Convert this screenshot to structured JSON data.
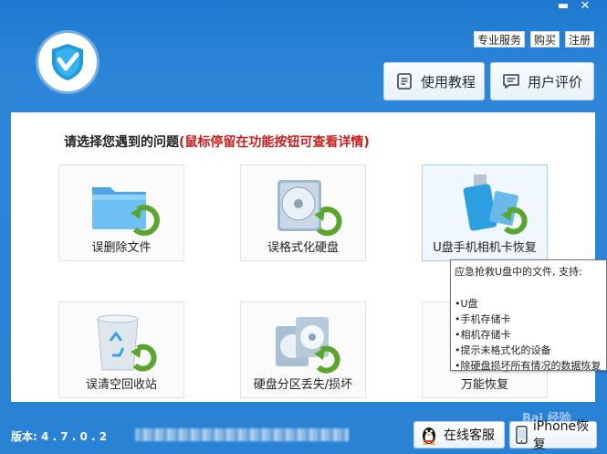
{
  "window": {
    "minimize_glyph": "▬",
    "close_glyph": "✕"
  },
  "top_links": [
    "专业服务",
    "购买",
    "注册"
  ],
  "header_buttons": {
    "tutorial": "使用教程",
    "review": "用户评价"
  },
  "prompt": {
    "main": "请选择您遇到的问题",
    "hint": "(鼠标停留在功能按钮可查看详情)"
  },
  "tiles": [
    {
      "label": "误删除文件",
      "icon": "folder-restore-icon"
    },
    {
      "label": "误格式化硬盘",
      "icon": "disk-restore-icon"
    },
    {
      "label": "U盘手机相机卡恢复",
      "icon": "usb-card-restore-icon"
    },
    {
      "label": "误清空回收站",
      "icon": "recycle-bin-restore-icon"
    },
    {
      "label": "硬盘分区丢失/损坏",
      "icon": "partition-restore-icon"
    },
    {
      "label": "万能恢复",
      "icon": "universal-restore-icon"
    }
  ],
  "tooltip": {
    "head": "应急抢救U盘中的文件, 支持:",
    "items": [
      "•U盘",
      "•手机存储卡",
      "•相机存储卡",
      "•提示未格式化的设备",
      "•除硬盘损坏所有情况的数据恢复"
    ]
  },
  "footer": {
    "version": "版本: 4 . 7 . 0 . 2",
    "service_button": "在线客服",
    "iphone_button": "iPhone恢复",
    "watermark": "Bai 经验"
  },
  "colors": {
    "window_blue": "#2b7fd0",
    "hint_red": "#cc1d1d",
    "accent_green": "#5aa52b"
  }
}
